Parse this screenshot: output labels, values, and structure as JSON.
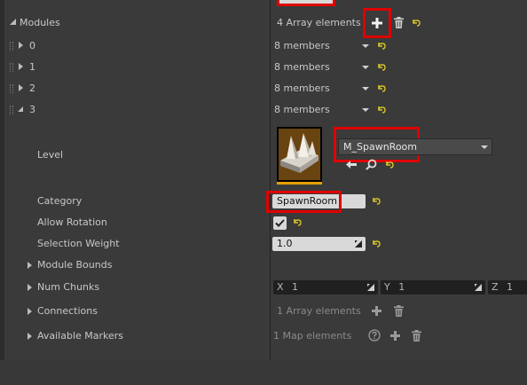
{
  "modules": {
    "label": "Modules",
    "count_text": "4 Array elements",
    "items": [
      {
        "index": "0",
        "value": "8 members"
      },
      {
        "index": "1",
        "value": "8 members"
      },
      {
        "index": "2",
        "value": "8 members"
      },
      {
        "index": "3",
        "value": "8 members"
      }
    ]
  },
  "level": {
    "label": "Level",
    "asset_name": "M_SpawnRoom"
  },
  "category": {
    "label": "Category",
    "value": "SpawnRoom"
  },
  "allow_rotation": {
    "label": "Allow Rotation",
    "checked": true
  },
  "selection_weight": {
    "label": "Selection Weight",
    "value": "1.0"
  },
  "module_bounds": {
    "label": "Module Bounds"
  },
  "num_chunks": {
    "label": "Num Chunks",
    "x_label": "X",
    "x_value": "1",
    "y_label": "Y",
    "y_value": "1",
    "z_label": "Z",
    "z_value": "1"
  },
  "connections": {
    "label": "Connections",
    "count_text": "1 Array elements"
  },
  "available_markers": {
    "label": "Available Markers",
    "count_text": "1 Map elements"
  },
  "colors": {
    "highlight_red": "#e00000",
    "reset_arrow": "#d6c22a",
    "thumbnail_accent": "#e8a000"
  }
}
